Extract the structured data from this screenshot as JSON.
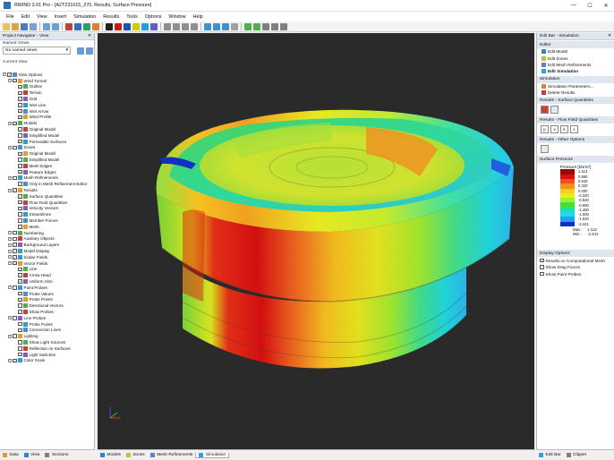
{
  "window": {
    "title": "RWIND 3.01 Pro - [A2T231015_270, Results, Surface Pressure]",
    "min": "—",
    "max": "☐",
    "close": "✕"
  },
  "menu": [
    "File",
    "Edit",
    "View",
    "Insert",
    "Simulation",
    "Results",
    "Tools",
    "Options",
    "Window",
    "Help"
  ],
  "navigator": {
    "title": "Project Navigator - View",
    "named_views_label": "Named Views",
    "named_views_value": "No named views",
    "current_view_label": "Current View",
    "tree": [
      {
        "d": 0,
        "label": "View Options",
        "c": "✓"
      },
      {
        "d": 1,
        "label": "Wind Tunnel",
        "c": "✓"
      },
      {
        "d": 2,
        "label": "Outline",
        "c": "✓"
      },
      {
        "d": 2,
        "label": "Terrain",
        "c": "✓"
      },
      {
        "d": 2,
        "label": "Grid",
        "c": "✓"
      },
      {
        "d": 2,
        "label": "Inlet Line",
        "c": "✓"
      },
      {
        "d": 2,
        "label": "Inlet Arrow",
        "c": "✓"
      },
      {
        "d": 2,
        "label": "Wind Profile",
        "c": "✓"
      },
      {
        "d": 1,
        "label": "Models",
        "c": "✓"
      },
      {
        "d": 2,
        "label": "Original Model",
        "c": "✓"
      },
      {
        "d": 2,
        "label": "Simplified Model",
        "c": ""
      },
      {
        "d": 2,
        "label": "Permeable Surfaces",
        "c": "✓"
      },
      {
        "d": 1,
        "label": "Zones",
        "c": ""
      },
      {
        "d": 2,
        "label": "Original Model",
        "c": "✓"
      },
      {
        "d": 2,
        "label": "Simplified Model",
        "c": ""
      },
      {
        "d": 2,
        "label": "Mesh Edges",
        "c": "✓"
      },
      {
        "d": 2,
        "label": "Feature Edges",
        "c": "✓"
      },
      {
        "d": 1,
        "label": "Mesh Refinements",
        "c": ""
      },
      {
        "d": 2,
        "label": "Only in Mesh Refinement Editor",
        "c": "✓"
      },
      {
        "d": 1,
        "label": "Results",
        "c": "✓"
      },
      {
        "d": 2,
        "label": "Surface Quantities",
        "c": "✓"
      },
      {
        "d": 2,
        "label": "Flow Field Quantities",
        "c": "✓"
      },
      {
        "d": 2,
        "label": "Velocity Vectors",
        "c": ""
      },
      {
        "d": 2,
        "label": "Streamlines",
        "c": ""
      },
      {
        "d": 2,
        "label": "Member Forces",
        "c": ""
      },
      {
        "d": 2,
        "label": "Mesh",
        "c": "✓"
      },
      {
        "d": 1,
        "label": "Numbering",
        "c": ""
      },
      {
        "d": 1,
        "label": "Auxiliary Objects",
        "c": ""
      },
      {
        "d": 1,
        "label": "Background Layers",
        "c": "✓"
      },
      {
        "d": 1,
        "label": "Model Display",
        "c": ""
      },
      {
        "d": 1,
        "label": "Scalar Fields",
        "c": "✓"
      },
      {
        "d": 1,
        "label": "Vector Fields",
        "c": "✓"
      },
      {
        "d": 2,
        "label": "Line",
        "c": "✓"
      },
      {
        "d": 2,
        "label": "Arrow Head",
        "c": "✓"
      },
      {
        "d": 2,
        "label": "Uniform Size",
        "c": "✓"
      },
      {
        "d": 1,
        "label": "Point Probes",
        "c": ""
      },
      {
        "d": 2,
        "label": "Probe Values",
        "c": "✓"
      },
      {
        "d": 2,
        "label": "Probe Points",
        "c": "✓"
      },
      {
        "d": 2,
        "label": "Directional Vectors",
        "c": ""
      },
      {
        "d": 2,
        "label": "Show Probes",
        "c": "✓"
      },
      {
        "d": 1,
        "label": "Line Probes",
        "c": ""
      },
      {
        "d": 2,
        "label": "Probe Points",
        "c": ""
      },
      {
        "d": 2,
        "label": "Connection Lines",
        "c": "✓"
      },
      {
        "d": 1,
        "label": "Lighting",
        "c": ""
      },
      {
        "d": 2,
        "label": "Show Light Sources",
        "c": ""
      },
      {
        "d": 2,
        "label": "Reflection on Surfaces",
        "c": ""
      },
      {
        "d": 2,
        "label": "Light Switches",
        "c": ""
      },
      {
        "d": 1,
        "label": "Color Scale",
        "c": "✓"
      }
    ]
  },
  "left_tabs": [
    "Data",
    "View",
    "Sections"
  ],
  "bottom_tabs": [
    "Models",
    "Zones",
    "Mesh Refinements",
    "Simulation"
  ],
  "right_panel": {
    "title": "Edit Bar - Simulation",
    "editor_label": "Editor",
    "editor_items": [
      "Edit Model",
      "Edit Zones",
      "Edit Mesh Refinements",
      "Edit Simulation"
    ],
    "simulation_label": "Simulation",
    "simulation_items": [
      "Simulation Parameters...",
      "Delete Results"
    ],
    "surface_label": "Results - Surface Quantities",
    "flow_label": "Results - Flow Field Quantities",
    "flow_buttons": [
      "p",
      "v",
      "k",
      "ε"
    ],
    "other_label": "Results - Other Options",
    "sp_label": "Surface Pressure",
    "legend_title": "Pressure [kN/m²]",
    "legend_values": [
      "1.113",
      "0.960",
      "0.640",
      "0.320",
      "0.000",
      "-0.320",
      "-0.640",
      "-0.960",
      "-1.280",
      "-1.600",
      "-1.920",
      "-2.441"
    ],
    "legend_colors": [
      "#a00000",
      "#d81010",
      "#f05020",
      "#f89020",
      "#f8d020",
      "#e0f020",
      "#a0f030",
      "#40e040",
      "#20e0a0",
      "#20d8f0",
      "#20a0f0",
      "#1030c0"
    ],
    "max_label": "Max :",
    "max_value": "1.113",
    "min_label": "Min :",
    "min_value": "-2.441",
    "display_label": "Display Options",
    "display_options": [
      {
        "label": "Results on Computational Mesh",
        "checked": "✓"
      },
      {
        "label": "Show Drag Forces",
        "checked": ""
      },
      {
        "label": "Show Point Probes",
        "checked": ""
      }
    ]
  },
  "right_tabs": [
    "Edit Bar",
    "Clipper"
  ]
}
